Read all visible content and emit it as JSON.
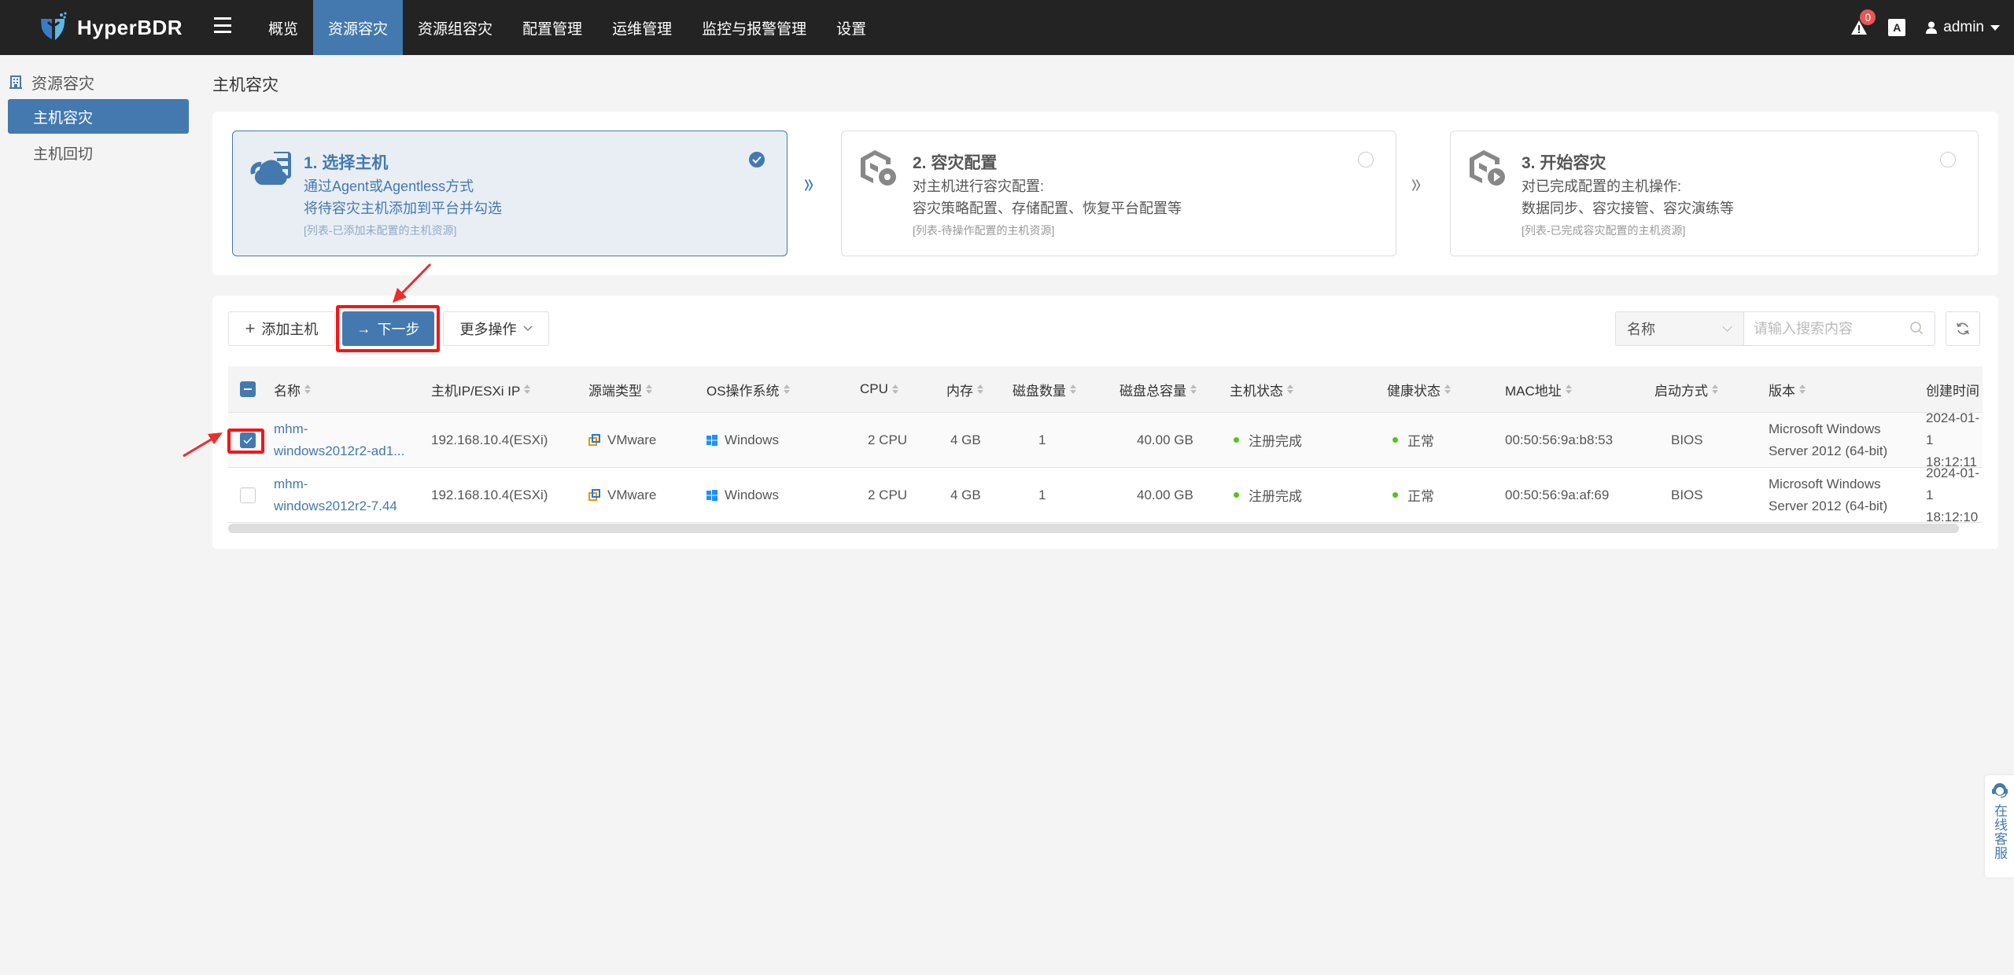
{
  "app": {
    "name": "HyperBDR"
  },
  "nav": {
    "items": [
      {
        "label": "概览",
        "active": false
      },
      {
        "label": "资源容灾",
        "active": true
      },
      {
        "label": "资源组容灾",
        "active": false
      },
      {
        "label": "配置管理",
        "active": false
      },
      {
        "label": "运维管理",
        "active": false
      },
      {
        "label": "监控与报警管理",
        "active": false
      },
      {
        "label": "设置",
        "active": false
      }
    ],
    "alert_count": "0",
    "lang_icon": "A",
    "user": "admin"
  },
  "sidebar": {
    "section": "资源容灾",
    "items": [
      {
        "label": "主机容灾",
        "active": true
      },
      {
        "label": "主机回切",
        "active": false
      }
    ]
  },
  "page": {
    "title": "主机容灾"
  },
  "steps": [
    {
      "title": "1. 选择主机",
      "line1": "通过Agent或Agentless方式",
      "line2": "将待容灾主机添加到平台并勾选",
      "note": "[列表-已添加未配置的主机资源]",
      "state": "done"
    },
    {
      "title": "2. 容灾配置",
      "line1": "对主机进行容灾配置:",
      "line2": "容灾策略配置、存储配置、恢复平台配置等",
      "note": "[列表-待操作配置的主机资源]",
      "state": "pending"
    },
    {
      "title": "3. 开始容灾",
      "line1": "对已完成配置的主机操作:",
      "line2": "数据同步、容灾接管、容灾演练等",
      "note": "[列表-已完成容灾配置的主机资源]",
      "state": "pending"
    }
  ],
  "toolbar": {
    "add_label": "添加主机",
    "next_label": "下一步",
    "more_label": "更多操作",
    "search_field": "名称",
    "search_placeholder": "请输入搜索内容"
  },
  "table": {
    "columns": [
      "名称",
      "主机IP/ESXi IP",
      "源端类型",
      "OS操作系统",
      "CPU",
      "内存",
      "磁盘数量",
      "磁盘总容量",
      "主机状态",
      "健康状态",
      "MAC地址",
      "启动方式",
      "版本",
      "创建时间"
    ],
    "rows": [
      {
        "checked": true,
        "name_line1": "mhm-",
        "name_line2": "windows2012r2-ad1...",
        "ip": "192.168.10.4(ESXi)",
        "source": "VMware",
        "os": "Windows",
        "cpu": "2 CPU",
        "mem": "4 GB",
        "disks": "1",
        "capacity": "40.00 GB",
        "host_status": "注册完成",
        "health": "正常",
        "mac": "00:50:56:9a:b8:53",
        "boot": "BIOS",
        "version_line1": "Microsoft Windows",
        "version_line2": "Server 2012 (64-bit)",
        "created_line1": "2024-01-1",
        "created_line2": "18:12:11"
      },
      {
        "checked": false,
        "name_line1": "mhm-",
        "name_line2": "windows2012r2-7.44",
        "ip": "192.168.10.4(ESXi)",
        "source": "VMware",
        "os": "Windows",
        "cpu": "2 CPU",
        "mem": "4 GB",
        "disks": "1",
        "capacity": "40.00 GB",
        "host_status": "注册完成",
        "health": "正常",
        "mac": "00:50:56:9a:af:69",
        "boot": "BIOS",
        "version_line1": "Microsoft Windows",
        "version_line2": "Server 2012 (64-bit)",
        "created_line1": "2024-01-1",
        "created_line2": "18:12:10"
      }
    ]
  },
  "service": {
    "label": "在线客服"
  },
  "colors": {
    "accent": "#4479b0",
    "header_bg": "#232323",
    "status_ok": "#52c41a",
    "annotation": "#ff1111"
  }
}
